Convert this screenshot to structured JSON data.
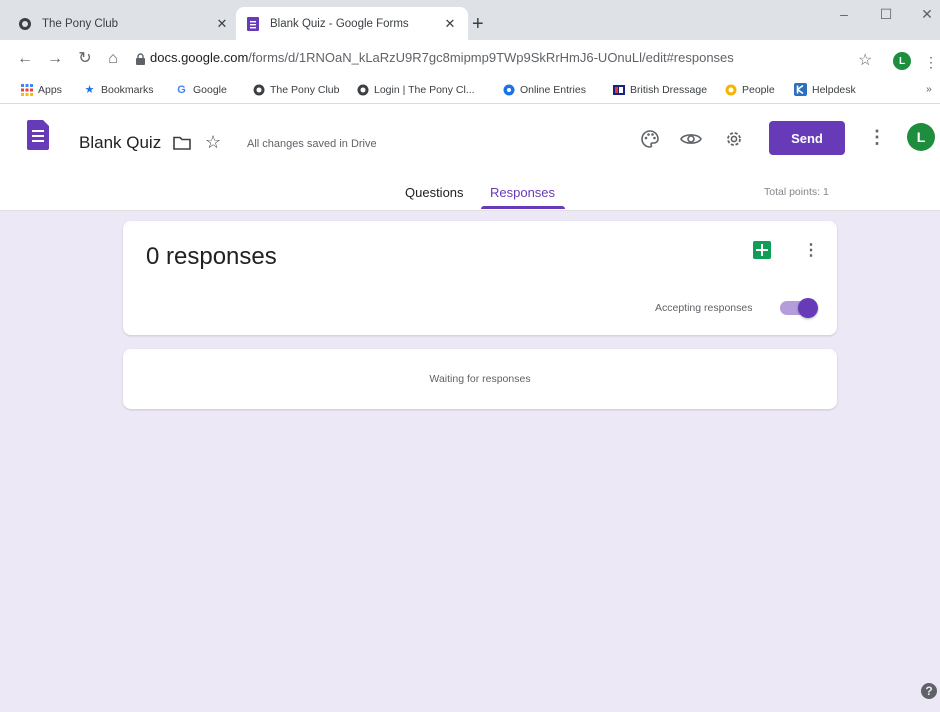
{
  "browser": {
    "tabs": [
      {
        "title": "The Pony Club",
        "close": "✕"
      },
      {
        "title": "Blank Quiz - Google Forms",
        "close": "✕"
      }
    ],
    "new_tab": "+",
    "window_controls": {
      "minimize": "–",
      "maximize": "☐",
      "close": "✕"
    },
    "url_host": "docs.google.com",
    "url_path": "/forms/d/1RNOaN_kLaRzU9R7gc8mipmp9TWp9SkRrHmJ6-UOnuLl/edit#responses",
    "profile_initial": "L",
    "bookmarks": [
      {
        "label": "Apps",
        "icon": "apps-grid-icon"
      },
      {
        "label": "Bookmarks",
        "icon": "star-icon"
      },
      {
        "label": "Google",
        "icon": "google-g-icon"
      },
      {
        "label": "The Pony Club",
        "icon": "pony-club-icon"
      },
      {
        "label": "Login | The Pony Cl...",
        "icon": "pony-club-icon"
      },
      {
        "label": "Online Entries",
        "icon": "online-entries-icon"
      },
      {
        "label": "British Dressage",
        "icon": "british-dressage-icon"
      },
      {
        "label": "People",
        "icon": "people-icon"
      },
      {
        "label": "Helpdesk",
        "icon": "helpdesk-icon"
      }
    ],
    "bookmarks_overflow": "»"
  },
  "form": {
    "title": "Blank Quiz",
    "save_status": "All changes saved in Drive",
    "send_label": "Send",
    "profile_initial": "L",
    "tabs": {
      "questions": "Questions",
      "responses": "Responses"
    },
    "total_points": "Total points: 1"
  },
  "responses": {
    "count_label": "0 responses",
    "accepting_label": "Accepting responses",
    "accepting": true,
    "waiting_label": "Waiting for responses"
  },
  "colors": {
    "accent": "#673ab7",
    "background": "#ede8f6",
    "sheets_green": "#0f9d58",
    "profile_green": "#1e8e3e"
  }
}
